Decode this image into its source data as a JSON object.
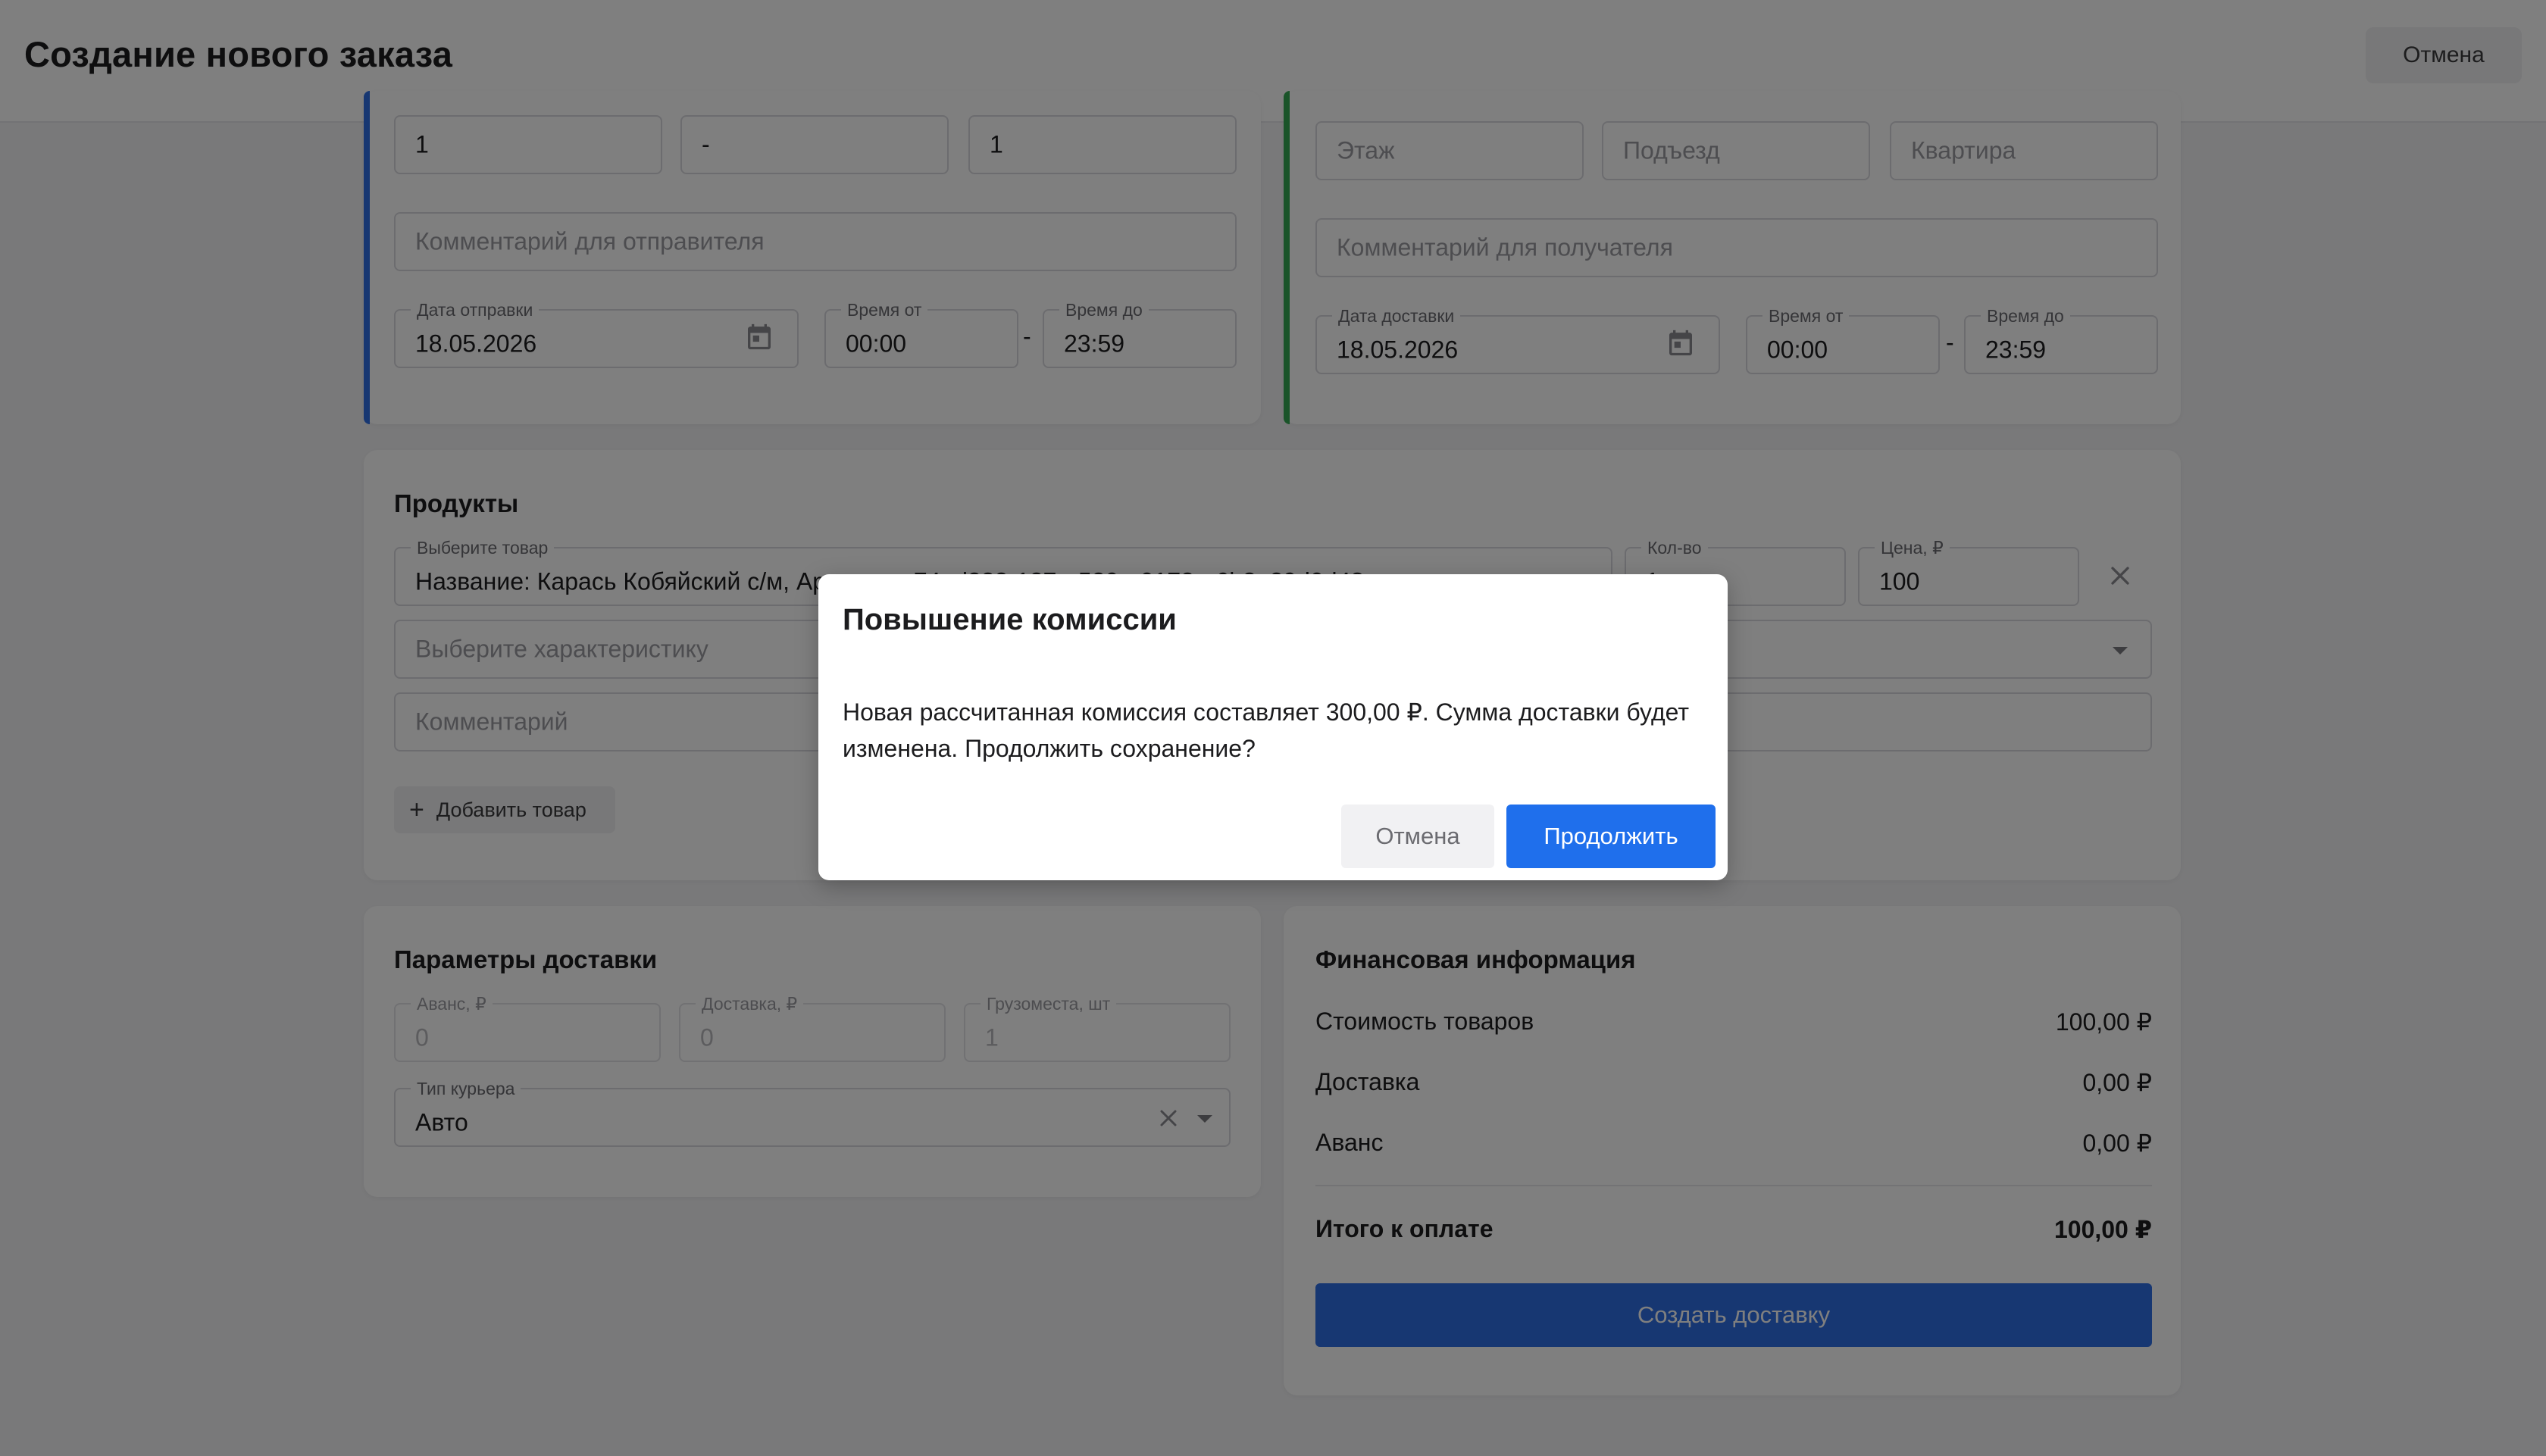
{
  "header": {
    "title": "Создание нового заказа",
    "cancel_label": "Отмена"
  },
  "sender": {
    "floor_value": "1",
    "entrance_value": "-",
    "apartment_value": "1",
    "comment_placeholder": "Комментарий для отправителя",
    "date_label": "Дата отправки",
    "date_value": "18.05.2026",
    "time_from_label": "Время от",
    "time_from_value": "00:00",
    "time_sep": "-",
    "time_to_label": "Время до",
    "time_to_value": "23:59",
    "accent_color": "#2f6fe4"
  },
  "recipient": {
    "floor_placeholder": "Этаж",
    "entrance_placeholder": "Подъезд",
    "apartment_placeholder": "Квартира",
    "comment_placeholder": "Комментарий для получателя",
    "date_label": "Дата доставки",
    "date_value": "18.05.2026",
    "time_from_label": "Время от",
    "time_from_value": "00:00",
    "time_sep": "-",
    "time_to_label": "Время до",
    "time_to_value": "23:59",
    "accent_color": "#34a853"
  },
  "products": {
    "title": "Продукты",
    "product_label": "Выберите товар",
    "product_value": "Название: Карась Кобяйский с/м, Артикул: a74ed333-127e-520e-0172-e6b8e29d0d48",
    "qty_label": "Кол-во",
    "qty_value": "1",
    "price_label": "Цена, ₽",
    "price_value": "100",
    "characteristic_placeholder": "Выберите характеристику",
    "comment_placeholder": "Комментарий",
    "add_label": "Добавить товар"
  },
  "delivery": {
    "title": "Параметры доставки",
    "advance_label": "Аванс, ₽",
    "advance_value": "0",
    "delivery_label": "Доставка, ₽",
    "delivery_value": "0",
    "cargo_label": "Грузоместа, шт",
    "cargo_value": "1",
    "courier_label": "Тип курьера",
    "courier_value": "Авто"
  },
  "finance": {
    "title": "Финансовая информация",
    "rows": [
      {
        "label": "Стоимость товаров",
        "amount": "100,00 ₽"
      },
      {
        "label": "Доставка",
        "amount": "0,00 ₽"
      },
      {
        "label": "Аванс",
        "amount": "0,00 ₽"
      }
    ],
    "total_label": "Итого к оплате",
    "total_amount": "100,00 ₽",
    "create_label": "Создать доставку"
  },
  "modal": {
    "title": "Повышение комиссии",
    "body": "Новая рассчитанная комиссия составляет 300,00 ₽. Сумма доставки будет изменена. Продолжить сохранение?",
    "cancel_label": "Отмена",
    "continue_label": "Продолжить"
  },
  "colors": {
    "primary": "#1f6fec",
    "overlay": "rgba(0,0,0,0.5)"
  }
}
